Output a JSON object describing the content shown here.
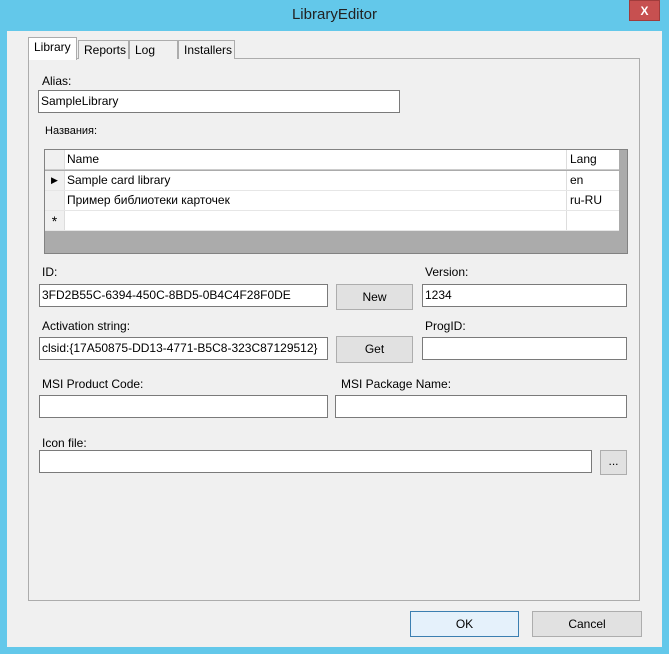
{
  "window": {
    "title": "LibraryEditor",
    "close_label": "X"
  },
  "tabs": [
    {
      "label": "Library"
    },
    {
      "label": "Reports"
    },
    {
      "label": "Log"
    },
    {
      "label": "Installers"
    }
  ],
  "alias": {
    "label": "Alias:",
    "value": "SampleLibrary"
  },
  "names": {
    "label": "Названия:",
    "columns": [
      "Name",
      "Lang"
    ],
    "rows": [
      {
        "name": "Sample card library",
        "lang": "en"
      },
      {
        "name": "Пример библиотеки карточек",
        "lang": "ru-RU"
      }
    ],
    "new_row_marker": "*",
    "current_row_marker": "▶"
  },
  "id": {
    "label": "ID:",
    "value": "3FD2B55C-6394-450C-8BD5-0B4C4F28F0DE",
    "button": "New"
  },
  "version": {
    "label": "Version:",
    "value": "1234"
  },
  "activation": {
    "label": "Activation string:",
    "value": "clsid:{17A50875-DD13-4771-B5C8-323C87129512}",
    "button": "Get"
  },
  "progid": {
    "label": "ProgID:",
    "value": ""
  },
  "msi_product": {
    "label": "MSI Product Code:",
    "value": ""
  },
  "msi_package": {
    "label": "MSI Package Name:",
    "value": ""
  },
  "icon_file": {
    "label": "Icon file:",
    "value": "",
    "button": "..."
  },
  "footer": {
    "ok": "OK",
    "cancel": "Cancel"
  }
}
